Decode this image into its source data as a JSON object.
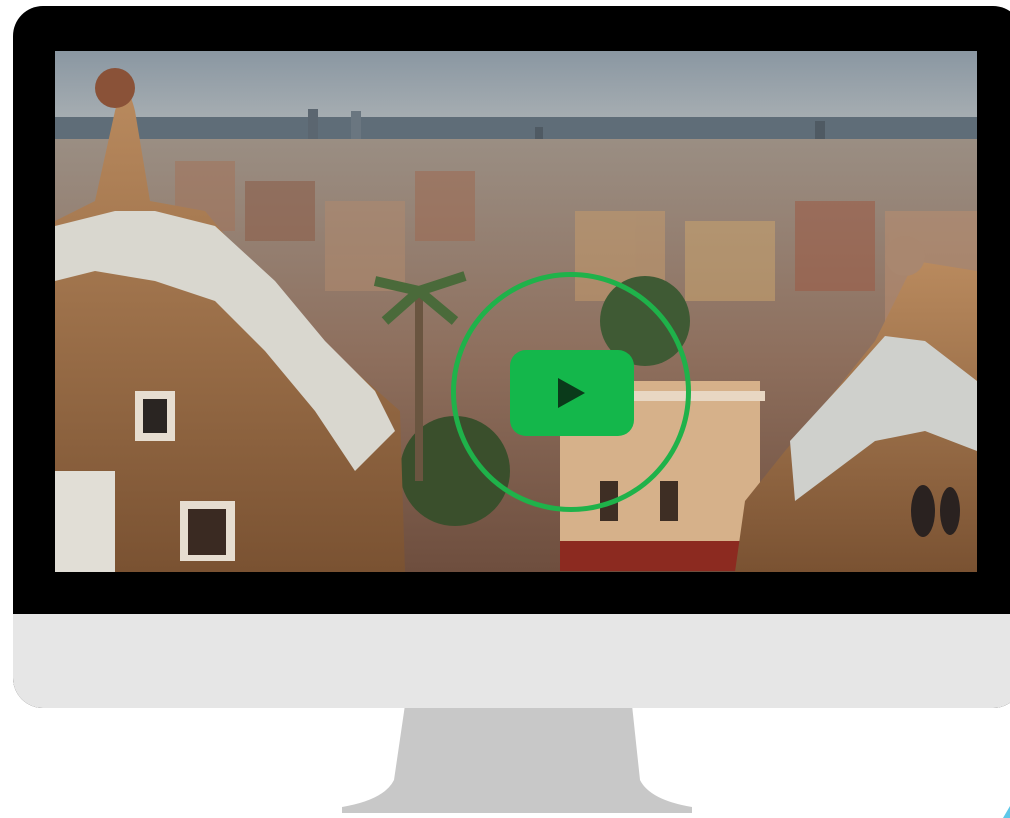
{
  "device": {
    "type": "desktop-monitor",
    "frame_color": "#000000",
    "chin_color": "#e6e6e6",
    "stand_color": "#c8c8c8"
  },
  "video": {
    "scene": "photo",
    "play_button": {
      "icon": "play-icon",
      "accent_color": "#14b74b",
      "ring_color": "#1fb24a"
    }
  }
}
